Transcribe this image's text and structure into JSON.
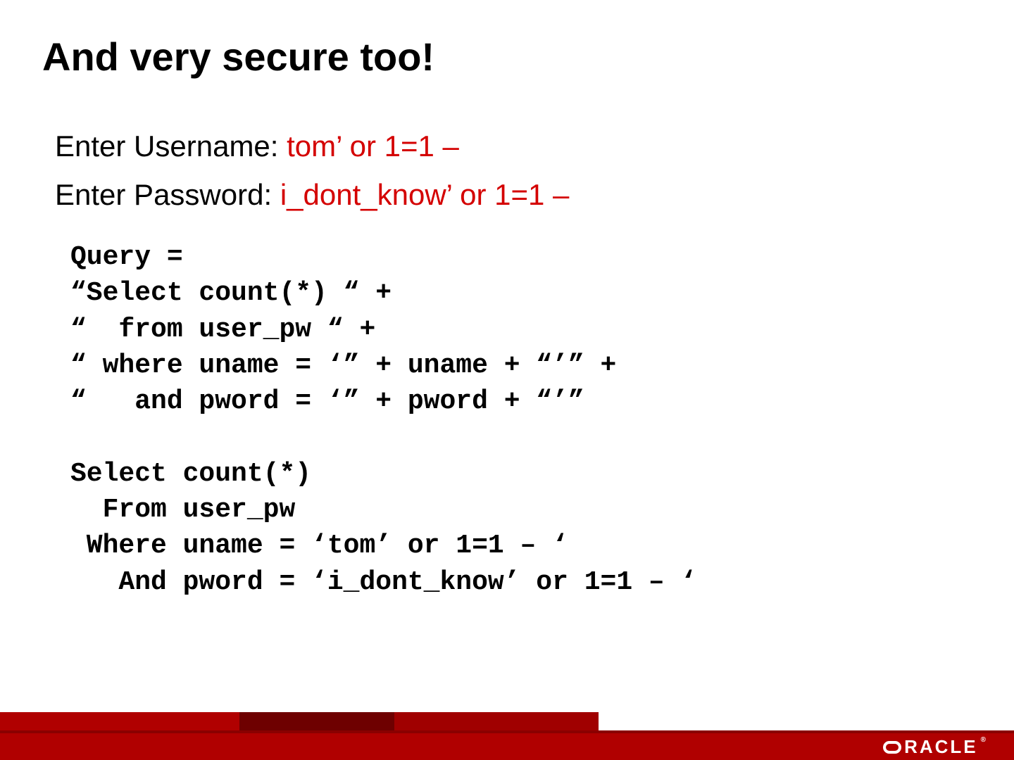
{
  "title": "And very secure too!",
  "prompts": {
    "username_label": "Enter Username: ",
    "username_value": "tom’ or 1=1 –",
    "password_label": "Enter Password: ",
    "password_value": "i_dont_know’ or 1=1 –"
  },
  "code": {
    "l1": "Query =",
    "l2": "“Select count(*) “ +",
    "l3": "“  from user_pw “ +",
    "l4": "“ where uname = ‘” + uname + “’” +",
    "l5": "“   and pword = ‘” + pword + “’”",
    "l6": "",
    "l7": "Select count(*)",
    "l8": "  From user_pw",
    "l9": " Where uname = ‘tom’ or 1=1 – ‘",
    "l10": "   And pword = ‘i_dont_know’ or 1=1 – ‘"
  },
  "footer": {
    "brand_rest": "RACLE",
    "reg": "®"
  },
  "colors": {
    "accent_red": "#d40000",
    "footer_red": "#b00000"
  }
}
